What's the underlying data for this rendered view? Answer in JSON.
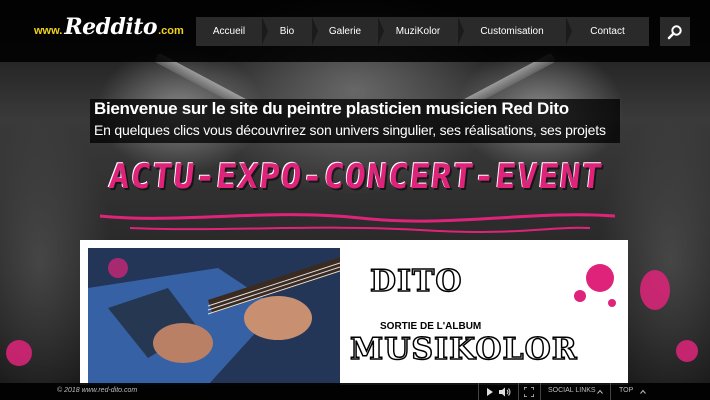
{
  "logo": {
    "prefix": "www.",
    "name": "Reddito",
    "suffix": ".com"
  },
  "nav": {
    "items": [
      {
        "label": "Accueil"
      },
      {
        "label": "Bio"
      },
      {
        "label": "Galerie"
      },
      {
        "label": "MuziKolor"
      },
      {
        "label": "Customisation"
      },
      {
        "label": "Contact"
      }
    ]
  },
  "search": {
    "icon": "search-icon"
  },
  "welcome": {
    "title": "Bienvenue sur le site du peintre plasticien musicien Red Dito",
    "subtitle": "En quelques clics vous découvrirez son univers singulier, ses réalisations, ses projets"
  },
  "banner": {
    "text": "ACTU-EXPO-CONCERT-EVENT"
  },
  "feature": {
    "artist": "DITO",
    "caption": "SORTIE DE L'ALBUM",
    "album": "MUSIKOLOR"
  },
  "footer": {
    "copyright": "© 2018 www.red-dito.com",
    "social_label": "SOCIAL LINKS",
    "top_label": "TOP"
  },
  "colors": {
    "accent": "#e0237a",
    "logo_yellow": "#f2d21b",
    "nav_bg": "#2a2a2a"
  }
}
